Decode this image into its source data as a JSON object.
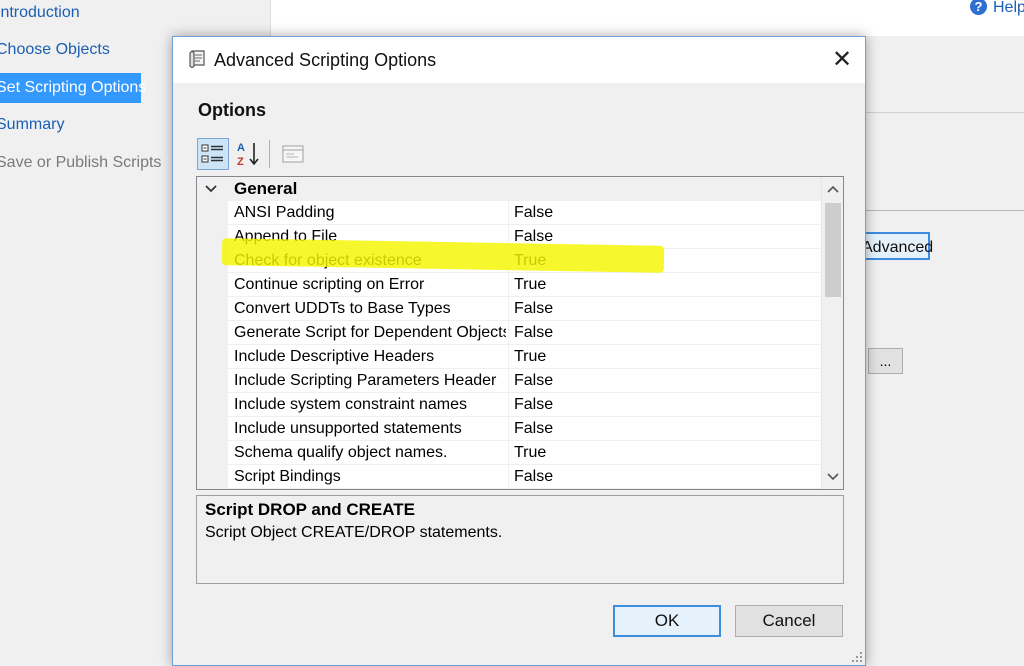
{
  "wizard": {
    "nav_items": [
      {
        "label": "Introduction",
        "state": "normal"
      },
      {
        "label": "Choose Objects",
        "state": "normal"
      },
      {
        "label": "Set Scripting Options",
        "state": "active"
      },
      {
        "label": "Summary",
        "state": "normal"
      },
      {
        "label": "Save or Publish Scripts",
        "state": "disabled"
      }
    ],
    "help_label": "Help",
    "advanced_label": "Advanced",
    "ellipsis_label": "..."
  },
  "dialog": {
    "title": "Advanced Scripting Options",
    "title_icon": "scroll-icon",
    "close_glyph": "✕",
    "options_heading": "Options",
    "toolbar": {
      "categorized_icon": "categorized-icon",
      "alphabetical_icon": "sort-alphabetical-icon",
      "pages_icon": "property-pages-icon"
    },
    "grid": {
      "category": "General",
      "highlighted_property": "Check for object existence",
      "highlight_color": "#f5f500",
      "rows": [
        {
          "name": "ANSI Padding",
          "value": "False"
        },
        {
          "name": "Append to File",
          "value": "False"
        },
        {
          "name": "Check for object existence",
          "value": "True"
        },
        {
          "name": "Continue scripting on Error",
          "value": "True"
        },
        {
          "name": "Convert UDDTs to Base Types",
          "value": "False"
        },
        {
          "name": "Generate Script for Dependent Objects",
          "value": "False"
        },
        {
          "name": "Include Descriptive Headers",
          "value": "True"
        },
        {
          "name": "Include Scripting Parameters Header",
          "value": "False"
        },
        {
          "name": "Include system constraint names",
          "value": "False"
        },
        {
          "name": "Include unsupported statements",
          "value": "False"
        },
        {
          "name": "Schema qualify object names.",
          "value": "True"
        },
        {
          "name": "Script Bindings",
          "value": "False"
        }
      ]
    },
    "description": {
      "title": "Script DROP and CREATE",
      "text": "Script Object CREATE/DROP statements."
    },
    "ok_label": "OK",
    "cancel_label": "Cancel"
  },
  "colors": {
    "accent": "#3399ff",
    "link": "#1a5fb4",
    "default_button_border": "#3c8ce0"
  }
}
